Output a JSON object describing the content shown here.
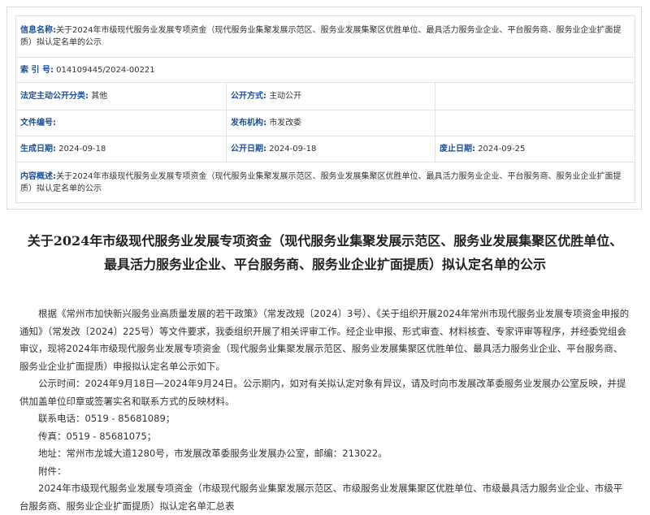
{
  "meta": {
    "info_name_label": "信息名称:",
    "info_name_value": "关于2024年市级现代服务业发展专项资金（现代服务业集聚发展示范区、服务业发展集聚区优胜单位、最具活力服务业企业、平台服务商、服务业企业扩面提质）拟认定名单的公示",
    "index_label": "索 引 号:",
    "index_value": "014109445/2024-00221",
    "category_label": "法定主动公开分类:",
    "category_value": "其他",
    "method_label": "公开方式:",
    "method_value": "主动公开",
    "doc_no_label": "文件编号:",
    "doc_no_value": "",
    "publisher_label": "发布机构:",
    "publisher_value": "市发改委",
    "created_label": "生成日期:",
    "created_value": "2024-09-18",
    "public_date_label": "公开日期:",
    "public_date_value": "2024-09-18",
    "expire_label": "废止日期:",
    "expire_value": "2024-09-25",
    "summary_label": "内容概述:",
    "summary_value": "关于2024年市级现代服务业发展专项资金（现代服务业集聚发展示范区、服务业发展集聚区优胜单位、最具活力服务业企业、平台服务商、服务业企业扩面提质）拟认定名单的公示"
  },
  "article": {
    "title": "关于2024年市级现代服务业发展专项资金（现代服务业集聚发展示范区、服务业发展集聚区优胜单位、最具活力服务业企业、平台服务商、服务业企业扩面提质）拟认定名单的公示",
    "para1": "根据《常州市加快新兴服务业高质量发展的若干政策》（常发改规〔2024〕3号）、《关于组织开展2024年常州市现代服务业发展专项资金申报的通知》（常发改〔2024〕225号）等文件要求，我委组织开展了相关评审工作。经企业申报、形式审查、材料核查、专家评审等程序，并经委党组会审议，现将2024年市级现代服务业发展专项资金（现代服务业集聚发展示范区、服务业发展集聚区优胜单位、最具活力服务业企业、平台服务商、服务业企业扩面提质）申报拟认定名单公示如下。",
    "para2": "公示时间：2024年9月18日—2024年9月24日。公示期内，如对有关拟认定对象有异议，请及时向市发展改革委服务业发展办公室反映，并提供加盖单位印章或签署实名和联系方式的反映材料。",
    "phone": "联系电话：0519 - 85681089；",
    "fax": "传真：0519 - 85681075；",
    "address": "地址：常州市龙城大道1280号，市发展改革委服务业发展办公室，邮编：213022。",
    "attachment_label": "附件：",
    "attachment_text": "2024年市级现代服务业发展专项资金（市级现代服务业集聚发展示范区、市级服务业发展集聚区优胜单位、市级最具活力服务业企业、市级平台服务商、服务业企业扩面提质）拟认定名单汇总表"
  }
}
